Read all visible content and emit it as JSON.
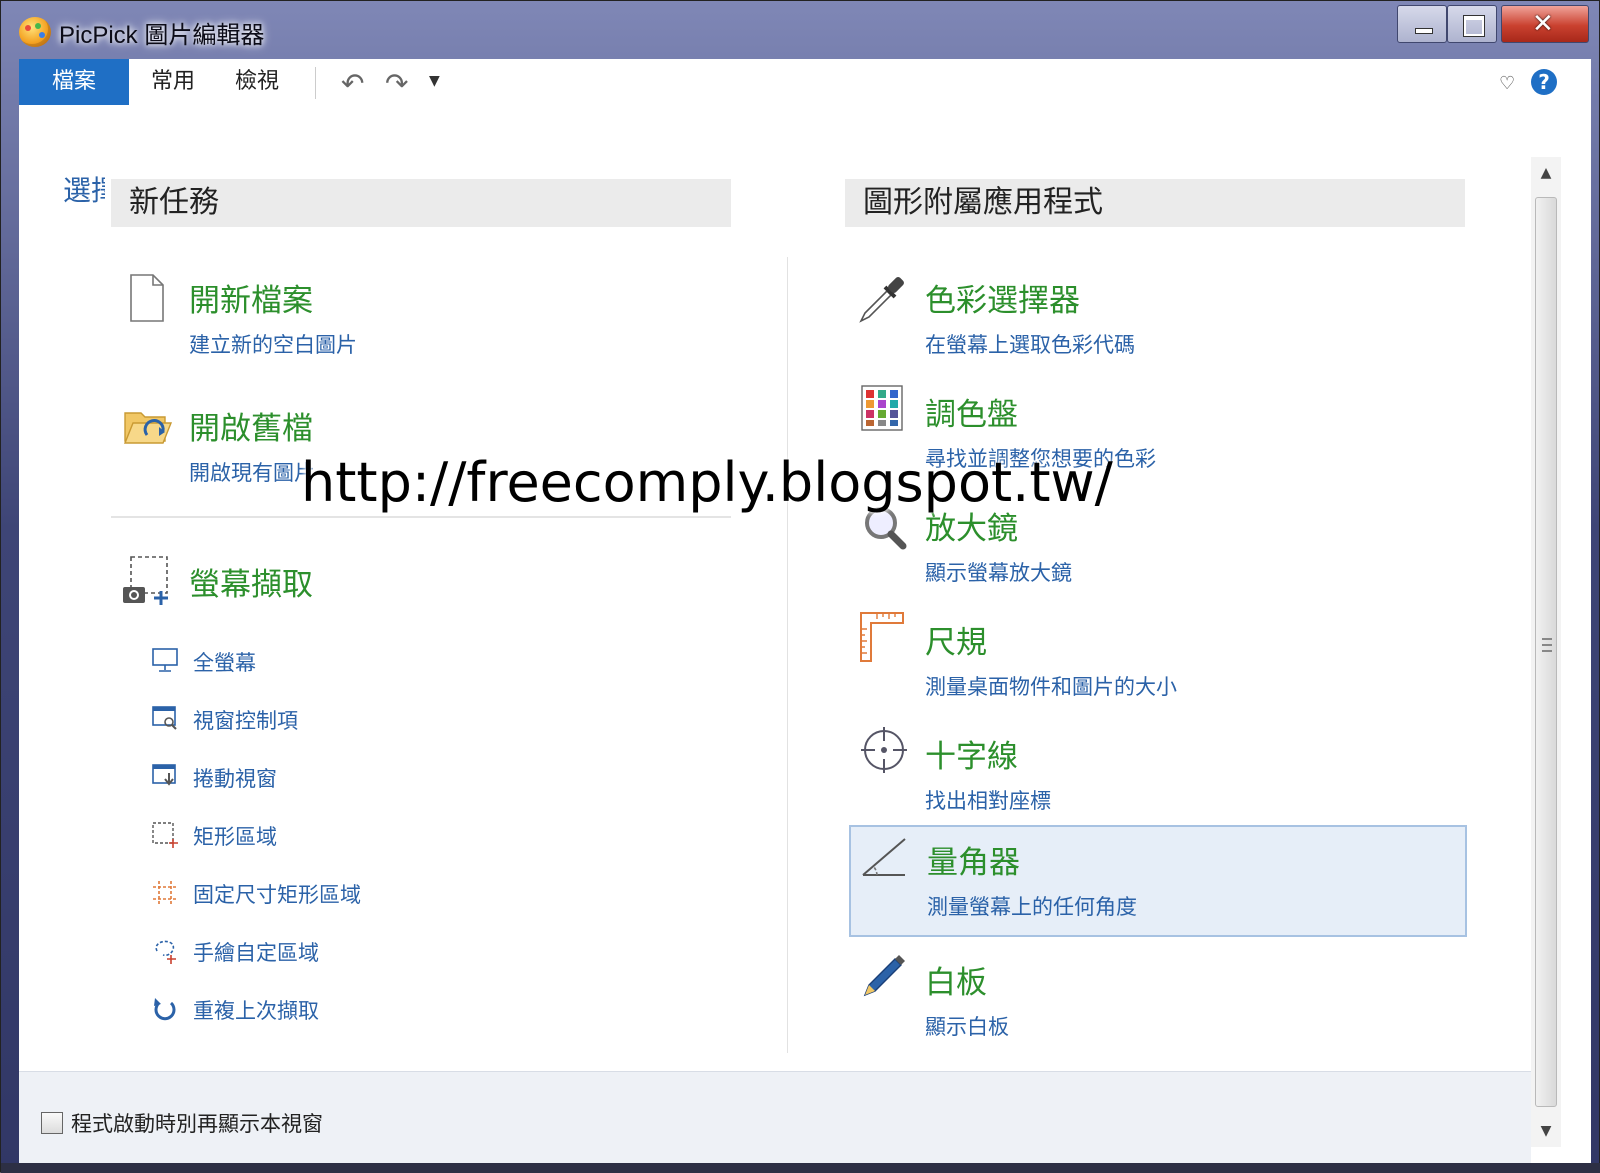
{
  "window": {
    "title": "PicPick 圖片編輯器"
  },
  "ribbon": {
    "tabs": [
      {
        "label": "檔案",
        "active": true
      },
      {
        "label": "常用"
      },
      {
        "label": "檢視"
      }
    ],
    "undo_icon": "undo-icon",
    "redo_icon": "redo-icon",
    "help": "?"
  },
  "partial_label": "選擇",
  "left": {
    "header": "新任務",
    "items": [
      {
        "title": "開新檔案",
        "desc": "建立新的空白圖片",
        "icon": "new-file-icon"
      },
      {
        "title": "開啟舊檔",
        "desc": "開啟現有圖片",
        "icon": "folder-open-icon"
      },
      {
        "title": "螢幕擷取",
        "icon": "screen-capture-icon"
      }
    ],
    "capture_options": [
      {
        "label": "全螢幕",
        "icon": "monitor-icon"
      },
      {
        "label": "視窗控制項",
        "icon": "window-control-icon"
      },
      {
        "label": "捲動視窗",
        "icon": "scroll-window-icon"
      },
      {
        "label": "矩形區域",
        "icon": "rect-region-icon"
      },
      {
        "label": "固定尺寸矩形區域",
        "icon": "fixed-rect-icon"
      },
      {
        "label": "手繪自定區域",
        "icon": "freehand-icon"
      },
      {
        "label": "重複上次擷取",
        "icon": "repeat-icon"
      }
    ]
  },
  "right": {
    "header": "圖形附屬應用程式",
    "items": [
      {
        "title": "色彩選擇器",
        "desc": "在螢幕上選取色彩代碼",
        "icon": "eyedropper-icon"
      },
      {
        "title": "調色盤",
        "desc": "尋找並調整您想要的色彩",
        "icon": "palette-icon"
      },
      {
        "title": "放大鏡",
        "desc": "顯示螢幕放大鏡",
        "icon": "magnifier-icon"
      },
      {
        "title": "尺規",
        "desc": "測量桌面物件和圖片的大小",
        "icon": "ruler-icon"
      },
      {
        "title": "十字線",
        "desc": "找出相對座標",
        "icon": "crosshair-icon"
      },
      {
        "title": "量角器",
        "desc": "測量螢幕上的任何角度",
        "icon": "protractor-icon",
        "selected": true
      },
      {
        "title": "白板",
        "desc": "顯示白板",
        "icon": "whiteboard-pen-icon"
      }
    ]
  },
  "footer": {
    "checkbox_label": "程式啟動時別再顯示本視窗",
    "checked": false
  },
  "watermark": "http://freecomply.blogspot.tw/",
  "colors": {
    "accent": "#1f6fc5",
    "title_green": "#2c8f2c",
    "desc_blue": "#2b62a8",
    "selection_bg": "#e6eef8"
  }
}
